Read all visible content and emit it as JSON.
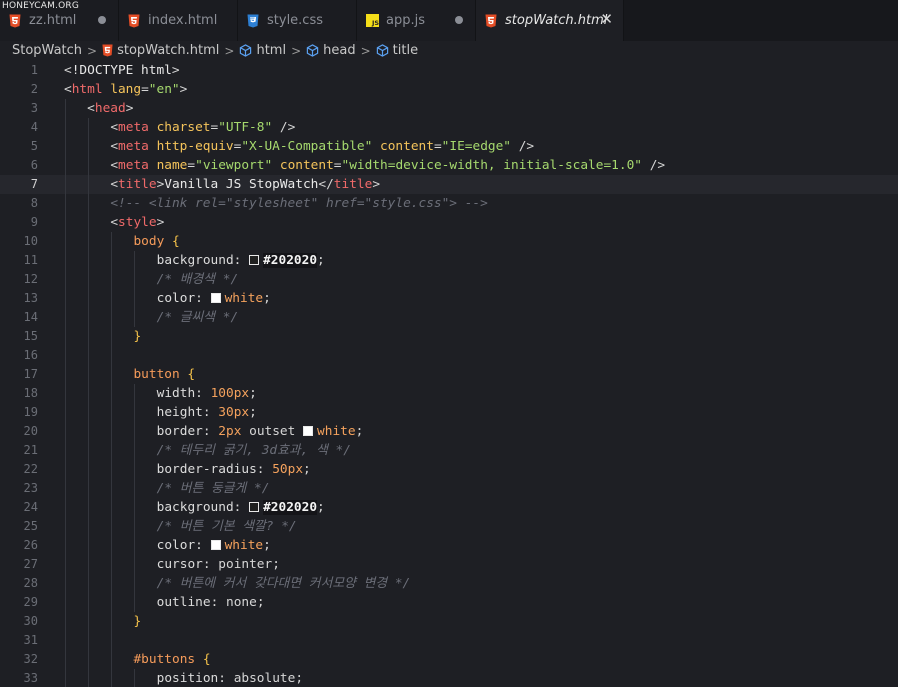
{
  "watermark": "HONEYCAM.ORG",
  "tabs": [
    {
      "name": "zz.html",
      "icon": "html5-icon",
      "modified": true,
      "active": false
    },
    {
      "name": "index.html",
      "icon": "html5-icon",
      "modified": false,
      "active": false
    },
    {
      "name": "style.css",
      "icon": "css3-icon",
      "modified": false,
      "active": false
    },
    {
      "name": "app.js",
      "icon": "js-icon",
      "modified": true,
      "active": false
    },
    {
      "name": "stopWatch.html",
      "icon": "html5-icon",
      "modified": false,
      "active": true
    }
  ],
  "breadcrumb": [
    {
      "label": "StopWatch",
      "icon": ""
    },
    {
      "label": "stopWatch.html",
      "icon": "html5-icon"
    },
    {
      "label": "html",
      "icon": "element-cube-icon"
    },
    {
      "label": "head",
      "icon": "element-cube-icon"
    },
    {
      "label": "title",
      "icon": "element-cube-icon"
    }
  ],
  "editor": {
    "current_line": 7,
    "colors": {
      "background": "#1e1f24",
      "tag": "#f06a6a",
      "attribute": "#f5c45b",
      "string": "#a6d96e",
      "comment": "#6b6e78",
      "selector": "#f59b5a",
      "number": "#f5a25d"
    },
    "lines": [
      {
        "n": 1,
        "indent": 0,
        "tokens": [
          [
            "punc",
            "<"
          ],
          [
            "doc",
            "!DOCTYPE html"
          ],
          [
            "punc",
            ">"
          ]
        ]
      },
      {
        "n": 2,
        "indent": 0,
        "tokens": [
          [
            "punc",
            "<"
          ],
          [
            "tag",
            "html"
          ],
          [
            "attr",
            " lang"
          ],
          [
            "punc",
            "="
          ],
          [
            "str",
            "\"en\""
          ],
          [
            "punc",
            ">"
          ]
        ]
      },
      {
        "n": 3,
        "indent": 1,
        "tokens": [
          [
            "punc",
            "<"
          ],
          [
            "tag",
            "head"
          ],
          [
            "punc",
            ">"
          ]
        ]
      },
      {
        "n": 4,
        "indent": 2,
        "tokens": [
          [
            "punc",
            "<"
          ],
          [
            "tag",
            "meta"
          ],
          [
            "attr",
            " charset"
          ],
          [
            "punc",
            "="
          ],
          [
            "str",
            "\"UTF-8\""
          ],
          [
            "punc",
            " />"
          ]
        ]
      },
      {
        "n": 5,
        "indent": 2,
        "tokens": [
          [
            "punc",
            "<"
          ],
          [
            "tag",
            "meta"
          ],
          [
            "attr",
            " http-equiv"
          ],
          [
            "punc",
            "="
          ],
          [
            "str",
            "\"X-UA-Compatible\""
          ],
          [
            "attr",
            " content"
          ],
          [
            "punc",
            "="
          ],
          [
            "str",
            "\"IE=edge\""
          ],
          [
            "punc",
            " />"
          ]
        ]
      },
      {
        "n": 6,
        "indent": 2,
        "tokens": [
          [
            "punc",
            "<"
          ],
          [
            "tag",
            "meta"
          ],
          [
            "attr",
            " name"
          ],
          [
            "punc",
            "="
          ],
          [
            "str",
            "\"viewport\""
          ],
          [
            "attr",
            " content"
          ],
          [
            "punc",
            "="
          ],
          [
            "str",
            "\"width=device-width, initial-scale=1.0\""
          ],
          [
            "punc",
            " />"
          ]
        ]
      },
      {
        "n": 7,
        "indent": 2,
        "tokens": [
          [
            "punc",
            "<"
          ],
          [
            "tag",
            "title"
          ],
          [
            "punc",
            ">"
          ],
          [
            "doc",
            "Vanilla JS StopWatch"
          ],
          [
            "punc",
            "</"
          ],
          [
            "tag",
            "title"
          ],
          [
            "punc",
            ">"
          ]
        ]
      },
      {
        "n": 8,
        "indent": 2,
        "tokens": [
          [
            "com",
            "<!-- <link rel=\"stylesheet\" href=\"style.css\"> -->"
          ]
        ]
      },
      {
        "n": 9,
        "indent": 2,
        "tokens": [
          [
            "punc",
            "<"
          ],
          [
            "tag",
            "style"
          ],
          [
            "punc",
            ">"
          ]
        ]
      },
      {
        "n": 10,
        "indent": 3,
        "tokens": [
          [
            "sel",
            "body"
          ],
          [
            "brace",
            " {"
          ]
        ]
      },
      {
        "n": 11,
        "indent": 4,
        "tokens": [
          [
            "prop",
            "background"
          ],
          [
            "punc",
            ": "
          ],
          [
            "swatch",
            "#202020"
          ],
          [
            "hex",
            "#202020"
          ],
          [
            "punc",
            ";"
          ]
        ]
      },
      {
        "n": 12,
        "indent": 4,
        "tokens": [
          [
            "com",
            "/* 배경색 */"
          ]
        ]
      },
      {
        "n": 13,
        "indent": 4,
        "tokens": [
          [
            "prop",
            "color"
          ],
          [
            "punc",
            ": "
          ],
          [
            "swatch",
            "#ffffff"
          ],
          [
            "col",
            "white"
          ],
          [
            "punc",
            ";"
          ]
        ]
      },
      {
        "n": 14,
        "indent": 4,
        "tokens": [
          [
            "com",
            "/* 글씨색 */"
          ]
        ]
      },
      {
        "n": 15,
        "indent": 3,
        "tokens": [
          [
            "brace",
            "}"
          ]
        ]
      },
      {
        "n": 16,
        "indent": 0,
        "tokens": []
      },
      {
        "n": 17,
        "indent": 3,
        "tokens": [
          [
            "sel",
            "button"
          ],
          [
            "brace",
            " {"
          ]
        ]
      },
      {
        "n": 18,
        "indent": 4,
        "tokens": [
          [
            "prop",
            "width"
          ],
          [
            "punc",
            ": "
          ],
          [
            "num",
            "100px"
          ],
          [
            "punc",
            ";"
          ]
        ]
      },
      {
        "n": 19,
        "indent": 4,
        "tokens": [
          [
            "prop",
            "height"
          ],
          [
            "punc",
            ": "
          ],
          [
            "num",
            "30px"
          ],
          [
            "punc",
            ";"
          ]
        ]
      },
      {
        "n": 20,
        "indent": 4,
        "tokens": [
          [
            "prop",
            "border"
          ],
          [
            "punc",
            ": "
          ],
          [
            "num",
            "2px"
          ],
          [
            "val",
            " outset "
          ],
          [
            "swatch",
            "#ffffff"
          ],
          [
            "col",
            "white"
          ],
          [
            "punc",
            ";"
          ]
        ]
      },
      {
        "n": 21,
        "indent": 4,
        "tokens": [
          [
            "com",
            "/* 테두리 굵기, 3d효과, 색 */"
          ]
        ]
      },
      {
        "n": 22,
        "indent": 4,
        "tokens": [
          [
            "prop",
            "border-radius"
          ],
          [
            "punc",
            ": "
          ],
          [
            "num",
            "50px"
          ],
          [
            "punc",
            ";"
          ]
        ]
      },
      {
        "n": 23,
        "indent": 4,
        "tokens": [
          [
            "com",
            "/* 버튼 둥글게 */"
          ]
        ]
      },
      {
        "n": 24,
        "indent": 4,
        "tokens": [
          [
            "prop",
            "background"
          ],
          [
            "punc",
            ": "
          ],
          [
            "swatch",
            "#202020"
          ],
          [
            "hex",
            "#202020"
          ],
          [
            "punc",
            ";"
          ]
        ]
      },
      {
        "n": 25,
        "indent": 4,
        "tokens": [
          [
            "com",
            "/* 버튼 기본 색깔? */"
          ]
        ]
      },
      {
        "n": 26,
        "indent": 4,
        "tokens": [
          [
            "prop",
            "color"
          ],
          [
            "punc",
            ": "
          ],
          [
            "swatch",
            "#ffffff"
          ],
          [
            "col",
            "white"
          ],
          [
            "punc",
            ";"
          ]
        ]
      },
      {
        "n": 27,
        "indent": 4,
        "tokens": [
          [
            "prop",
            "cursor"
          ],
          [
            "punc",
            ": "
          ],
          [
            "val",
            "pointer"
          ],
          [
            "punc",
            ";"
          ]
        ]
      },
      {
        "n": 28,
        "indent": 4,
        "tokens": [
          [
            "com",
            "/* 버튼에 커서 갖다대면 커서모양 변경 */"
          ]
        ]
      },
      {
        "n": 29,
        "indent": 4,
        "tokens": [
          [
            "prop",
            "outline"
          ],
          [
            "punc",
            ": "
          ],
          [
            "val",
            "none"
          ],
          [
            "punc",
            ";"
          ]
        ]
      },
      {
        "n": 30,
        "indent": 3,
        "tokens": [
          [
            "brace",
            "}"
          ]
        ]
      },
      {
        "n": 31,
        "indent": 0,
        "tokens": []
      },
      {
        "n": 32,
        "indent": 3,
        "tokens": [
          [
            "sel",
            "#buttons"
          ],
          [
            "brace",
            " {"
          ]
        ]
      },
      {
        "n": 33,
        "indent": 4,
        "tokens": [
          [
            "prop",
            "position"
          ],
          [
            "punc",
            ": "
          ],
          [
            "val",
            "absolute"
          ],
          [
            "punc",
            ";"
          ]
        ]
      }
    ]
  }
}
